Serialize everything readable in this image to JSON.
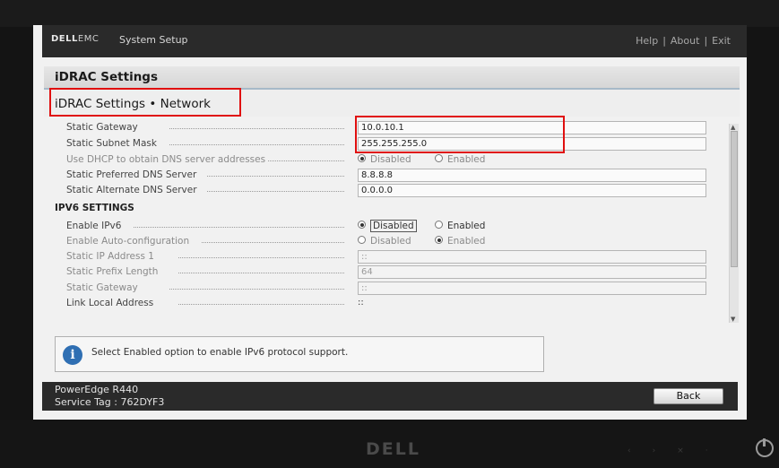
{
  "topbar": {
    "logo": "DELL",
    "logo_suffix": "EMC",
    "title": "System Setup",
    "links": [
      "Help",
      "About",
      "Exit"
    ]
  },
  "header": {
    "page_title": "iDRAC Settings",
    "section_title": "iDRAC Settings • Network"
  },
  "ipv4": {
    "static_gateway": {
      "label": "Static Gateway",
      "value": "10.0.10.1"
    },
    "static_subnet_mask": {
      "label": "Static Subnet Mask",
      "value": "255.255.255.0"
    },
    "dhcp_dns": {
      "label": "Use DHCP to obtain DNS server addresses",
      "opt1": "Disabled",
      "opt2": "Enabled",
      "selected": "Disabled"
    },
    "preferred_dns": {
      "label": "Static Preferred DNS Server",
      "value": "8.8.8.8"
    },
    "alternate_dns": {
      "label": "Static Alternate DNS Server",
      "value": "0.0.0.0"
    }
  },
  "ipv6": {
    "section_title": "IPV6 SETTINGS",
    "enable_ipv6": {
      "label": "Enable IPv6",
      "opt1": "Disabled",
      "opt2": "Enabled",
      "selected": "Disabled"
    },
    "auto_config": {
      "label": "Enable Auto-configuration",
      "opt1": "Disabled",
      "opt2": "Enabled",
      "selected": "Enabled"
    },
    "static_ip": {
      "label": "Static IP Address 1",
      "value": "::"
    },
    "prefix_length": {
      "label": "Static Prefix Length",
      "value": "64"
    },
    "static_gateway": {
      "label": "Static Gateway",
      "value": "::"
    },
    "link_local": {
      "label": "Link Local Address",
      "value": "::"
    }
  },
  "info": {
    "text": "Select Enabled option to enable IPv6 protocol support."
  },
  "bottombar": {
    "model": "PowerEdge R440",
    "service_tag": "Service Tag : 762DYF3",
    "back_label": "Back"
  },
  "monitor": {
    "brand": "DELL"
  }
}
